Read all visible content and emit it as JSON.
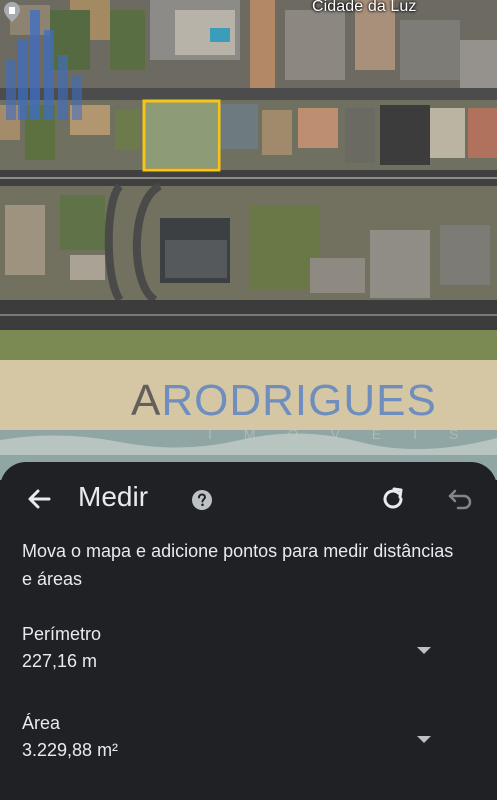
{
  "map": {
    "place_label": "Cidade da Luz",
    "place_icon": "pin-icon",
    "selection_color": "#f5c518",
    "watermark": {
      "brand_first": "A",
      "brand_rest": "RODRIGUES",
      "subtitle": "IMÓVEIS"
    }
  },
  "sheet": {
    "title": "Medir",
    "back_icon": "arrow-back-icon",
    "help_icon": "help-icon",
    "redo_icon": "redo-icon",
    "undo_icon": "undo-icon",
    "instructions": "Mova o mapa e adicione pontos para medir distâncias e áreas",
    "perimeter": {
      "label": "Perímetro",
      "value": "227,16 m"
    },
    "area": {
      "label": "Área",
      "value": "3.229,88 m²"
    }
  }
}
